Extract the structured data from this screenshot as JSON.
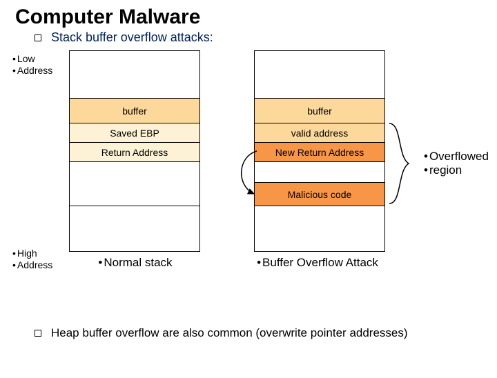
{
  "title": "Computer Malware",
  "subtitle": "Stack buffer overflow attacks:",
  "labels": {
    "low_addr_l1": "Low",
    "low_addr_l2": "Address",
    "high_addr_l1": "High",
    "high_addr_l2": "Address",
    "overflow_l1": "Overflowed",
    "overflow_l2": "region"
  },
  "normal_stack": {
    "caption": "Normal stack",
    "cells": {
      "buffer": "buffer",
      "saved_ebp": "Saved EBP",
      "return_addr": "Return Address"
    }
  },
  "attack_stack": {
    "caption": "Buffer Overflow Attack",
    "cells": {
      "buffer": "buffer",
      "valid_addr": "valid address",
      "new_ret": "New Return Address",
      "malicious": "Malicious code"
    }
  },
  "footer": "Heap buffer overflow are also common (overwrite pointer addresses)",
  "chart_data": {
    "type": "table",
    "title": "Stack buffer overflow comparison",
    "stacks": [
      {
        "name": "Normal stack",
        "layout_low_to_high": [
          "(empty)",
          "buffer",
          "Saved EBP",
          "Return Address",
          "(empty)",
          "(empty)"
        ]
      },
      {
        "name": "Buffer Overflow Attack",
        "layout_low_to_high": [
          "(empty)",
          "buffer",
          "valid address",
          "New Return Address",
          "(empty)",
          "Malicious code",
          "(empty)"
        ],
        "overflowed_region": [
          "valid address",
          "New Return Address",
          "(empty)",
          "Malicious code"
        ],
        "pointer": {
          "from": "New Return Address",
          "to": "Malicious code"
        }
      }
    ],
    "address_axis": {
      "top": "Low Address",
      "bottom": "High Address"
    }
  }
}
